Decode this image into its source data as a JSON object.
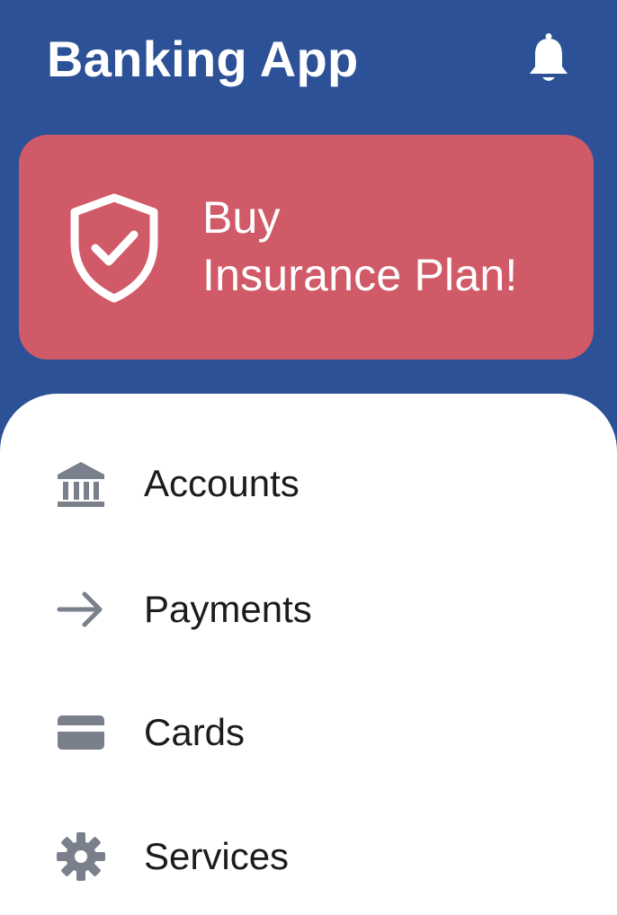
{
  "header": {
    "title": "Banking App",
    "notification_icon": "bell-icon"
  },
  "promo": {
    "icon": "shield-check-icon",
    "line1": "Buy",
    "line2": "Insurance Plan!",
    "background_color": "#d05a67"
  },
  "menu": {
    "items": [
      {
        "label": "Accounts",
        "icon": "bank-icon"
      },
      {
        "label": "Payments",
        "icon": "arrow-right-icon"
      },
      {
        "label": "Cards",
        "icon": "card-icon"
      },
      {
        "label": "Services",
        "icon": "gear-icon"
      }
    ]
  },
  "colors": {
    "primary": "#2c5196",
    "promo": "#d05a67",
    "icon_gray": "#7a7f8c",
    "text": "#1c1c1e",
    "surface": "#ffffff"
  }
}
